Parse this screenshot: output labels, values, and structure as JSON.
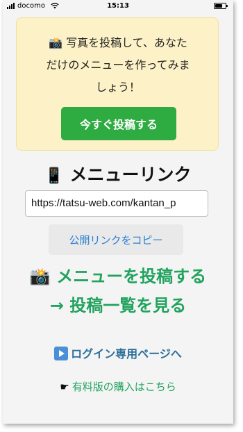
{
  "statusbar": {
    "carrier": "docomo",
    "time": "15:13"
  },
  "promo": {
    "icon": "camera-flash-icon",
    "icon_glyph": "📸",
    "text_line1": "写真を投稿して、あなた",
    "text_line2": "だけのメニューを作ってみま",
    "text_line3": "しょう！",
    "button_label": "今すぐ投稿する",
    "button_color": "#2eab41",
    "background": "#fdf2c7"
  },
  "menu_link": {
    "icon": "mobile-phone-icon",
    "icon_glyph": "📱",
    "title": "メニューリンク",
    "url_value": "https://tatsu-web.com/kantan_p",
    "copy_label": "公開リンクをコピー"
  },
  "actions": {
    "post_icon": "camera-flash-icon",
    "post_icon_glyph": "📸",
    "post_label": "メニューを投稿する",
    "list_label": "→ 投稿一覧を見る",
    "accent_color": "#21a35e"
  },
  "footer_links": {
    "login_icon": "play-button-icon",
    "login_label": "ログイン専用ページへ",
    "paid_icon": "pointing-hand-icon",
    "paid_icon_glyph": "☛",
    "paid_label": "有料版の購入はこちら"
  }
}
